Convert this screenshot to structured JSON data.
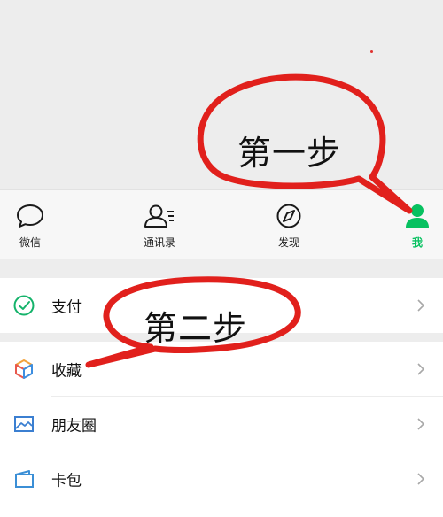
{
  "tabbar": {
    "tabs": [
      {
        "label": "微信",
        "icon": "chat-bubble-icon"
      },
      {
        "label": "通讯录",
        "icon": "contacts-icon"
      },
      {
        "label": "发现",
        "icon": "compass-icon"
      },
      {
        "label": "我",
        "icon": "person-icon",
        "active": true
      }
    ]
  },
  "menu": {
    "pay": {
      "label": "支付",
      "icon": "payment-check-icon"
    },
    "favorites": {
      "label": "收藏",
      "icon": "cube-icon"
    },
    "moments": {
      "label": "朋友圈",
      "icon": "picture-icon"
    },
    "cards": {
      "label": "卡包",
      "icon": "wallet-icon"
    }
  },
  "annotations": {
    "step1": "第一步",
    "step2": "第二步"
  },
  "colors": {
    "accent_green": "#07c160",
    "annotation_red": "#e1201c",
    "background": "#ededed"
  }
}
